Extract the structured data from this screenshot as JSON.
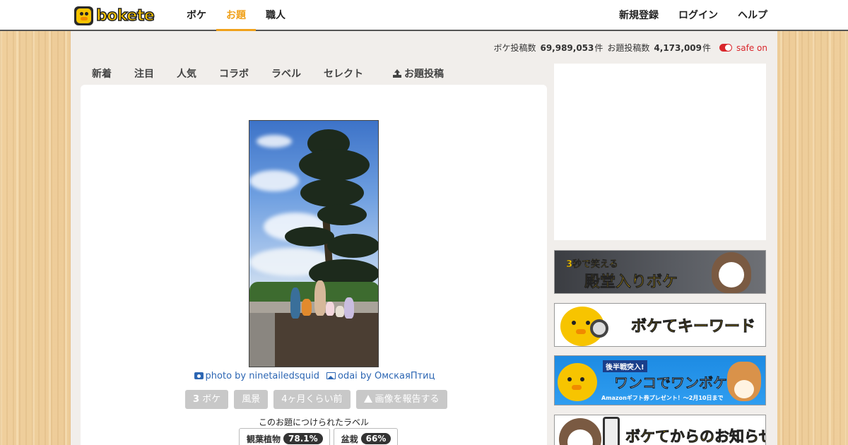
{
  "header": {
    "logo_text": "boketе",
    "nav_left": [
      "ボケ",
      "お題",
      "職人"
    ],
    "nav_active": "お題",
    "nav_right": [
      "新規登録",
      "ログイン",
      "ヘルプ"
    ]
  },
  "stats": {
    "boke_label": "ボケ投稿数",
    "boke_count": "69,989,053",
    "boke_unit": "件",
    "odai_label": "お題投稿数",
    "odai_count": "4,173,009",
    "odai_unit": "件",
    "safe_label": "safe on"
  },
  "tabs": [
    "新着",
    "注目",
    "人気",
    "コラボ",
    "ラベル",
    "セレクト",
    "お題投稿"
  ],
  "odai": {
    "photo_credit": "photo by ninetailedsquid",
    "odai_credit": "odai by ОмскаяПтиц",
    "boke_count_num": "3",
    "boke_count_label": "ボケ",
    "category": "風景",
    "time_ago": "4ヶ月くらい前",
    "report_label": "画像を報告する",
    "labels_title": "このお題につけられたラベル",
    "labels": [
      {
        "name": "観葉植物",
        "pct": "78.1%"
      },
      {
        "name": "盆栽",
        "pct": "66%"
      }
    ]
  },
  "sidebar": {
    "banner1_small": "3秒で笑える",
    "banner1_big": "殿堂入りボケ",
    "banner2": "ボケてキーワード",
    "banner3_small": "後半戦突入!",
    "banner3_big": "ワンコでワンボケ!",
    "banner3_sub": "Amazonギフト券プレゼント！〜2月10日まで",
    "banner4": "ボケてからのお知らせ"
  },
  "colors": {
    "accent": "#f0a11a",
    "link": "#2c66b3",
    "safe": "#d9262b"
  }
}
